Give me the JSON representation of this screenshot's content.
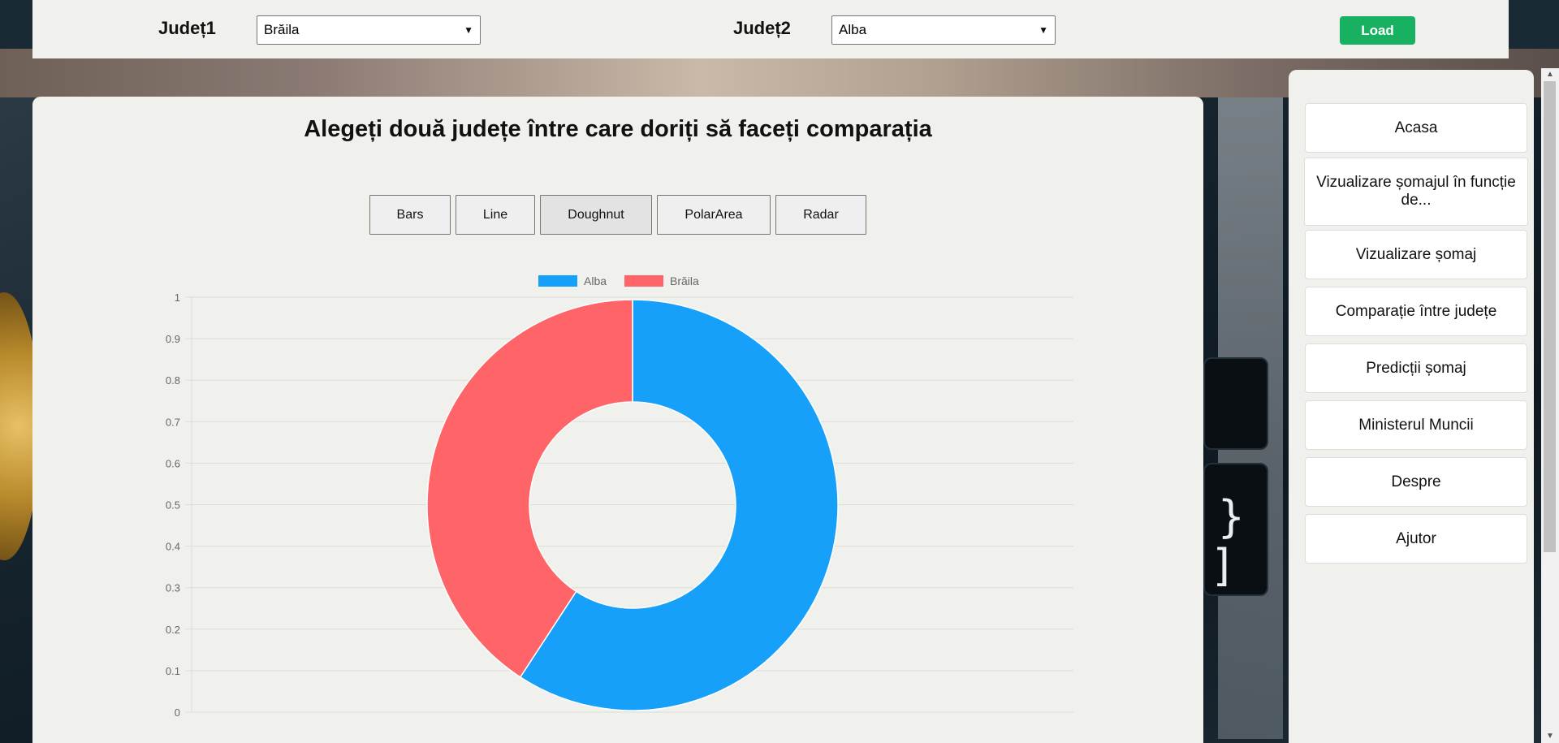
{
  "topbar": {
    "county1_label": "Județ1",
    "county1_value": "Brăila",
    "county2_label": "Județ2",
    "county2_value": "Alba",
    "load_label": "Load"
  },
  "main": {
    "title": "Alegeți două județe între care doriți să faceți comparația",
    "chart_types": [
      "Bars",
      "Line",
      "Doughnut",
      "PolarArea",
      "Radar"
    ],
    "active_chart_type": "Doughnut"
  },
  "sidebar": {
    "items": [
      "Acasa",
      "Vizualizare șomajul în funcție de...",
      "Vizualizare șomaj",
      "Comparație între județe",
      "Predicții șomaj",
      "Ministerul Muncii",
      "Despre",
      "Ajutor"
    ]
  },
  "colors": {
    "green_button": "#18b061",
    "alba": "#17a0fa",
    "braila": "#ff6468",
    "panel": "#f0f0ed"
  },
  "chart_data": {
    "type": "doughnut",
    "legend": [
      "Alba",
      "Brăila"
    ],
    "legend_placement": "top",
    "series": [
      {
        "name": "Alba",
        "value": 0.592,
        "color": "#17a0fa"
      },
      {
        "name": "Brăila",
        "value": 0.408,
        "color": "#ff6468"
      }
    ],
    "ylim": [
      0,
      1
    ],
    "yticks": [
      "0",
      "0.1",
      "0.2",
      "0.3",
      "0.4",
      "0.5",
      "0.6",
      "0.7",
      "0.8",
      "0.9",
      "1"
    ],
    "grid": true
  }
}
